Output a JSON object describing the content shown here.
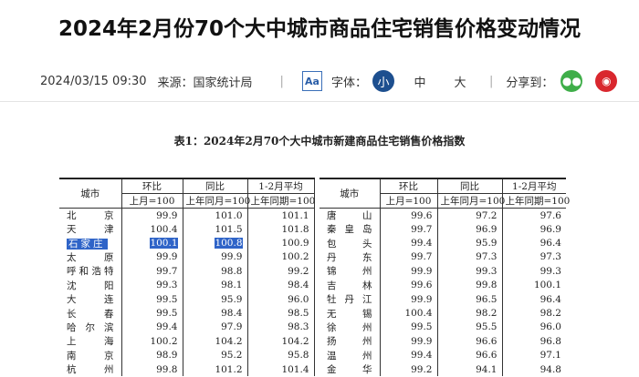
{
  "title": "2024年2月份70个大中城市商品住宅销售价格变动情况",
  "meta": {
    "datetime": "2024/03/15 09:30",
    "source": "来源：国家统计局",
    "aa": "Aa",
    "font_label": "字体：",
    "font_sizes": [
      "小",
      "中",
      "大"
    ],
    "share_label": "分享到：",
    "sep": "|"
  },
  "table": {
    "title": "表1：2024年2月70个大中城市新建商品住宅销售价格指数",
    "headers": {
      "city": "城市",
      "mom": "环比",
      "yoy": "同比",
      "avg": "1-2月平均",
      "mom_base": "上月=100",
      "yoy_base": "上年同月=100",
      "avg_base": "上年同期=100"
    },
    "left": [
      [
        "北　京",
        "99.9",
        "101.0",
        "101.1"
      ],
      [
        "天　津",
        "100.4",
        "101.5",
        "101.8"
      ],
      [
        "石家庄",
        "100.1",
        "100.8",
        "100.9"
      ],
      [
        "太　原",
        "99.9",
        "99.9",
        "100.2"
      ],
      [
        "呼和浩特",
        "99.7",
        "98.8",
        "99.2"
      ],
      [
        "沈　阳",
        "99.3",
        "98.1",
        "98.4"
      ],
      [
        "大　连",
        "99.5",
        "95.9",
        "96.0"
      ],
      [
        "长　春",
        "99.5",
        "98.4",
        "98.5"
      ],
      [
        "哈尔滨",
        "99.4",
        "97.9",
        "98.3"
      ],
      [
        "上　海",
        "100.2",
        "104.2",
        "104.2"
      ],
      [
        "南　京",
        "98.9",
        "95.2",
        "95.8"
      ],
      [
        "杭　州",
        "99.8",
        "101.2",
        "101.4"
      ]
    ],
    "right": [
      [
        "唐　山",
        "99.6",
        "97.2",
        "97.6"
      ],
      [
        "秦皇岛",
        "99.7",
        "96.9",
        "96.9"
      ],
      [
        "包　头",
        "99.4",
        "95.9",
        "96.4"
      ],
      [
        "丹　东",
        "99.7",
        "97.3",
        "97.3"
      ],
      [
        "锦　州",
        "99.9",
        "99.3",
        "99.3"
      ],
      [
        "吉　林",
        "99.6",
        "99.8",
        "100.1"
      ],
      [
        "牡丹江",
        "99.9",
        "96.5",
        "96.4"
      ],
      [
        "无　锡",
        "100.4",
        "98.2",
        "98.2"
      ],
      [
        "徐　州",
        "99.5",
        "95.5",
        "96.0"
      ],
      [
        "扬　州",
        "99.9",
        "96.6",
        "96.8"
      ],
      [
        "温　州",
        "99.4",
        "96.6",
        "97.1"
      ],
      [
        "金　华",
        "99.2",
        "94.1",
        "94.8"
      ]
    ]
  }
}
